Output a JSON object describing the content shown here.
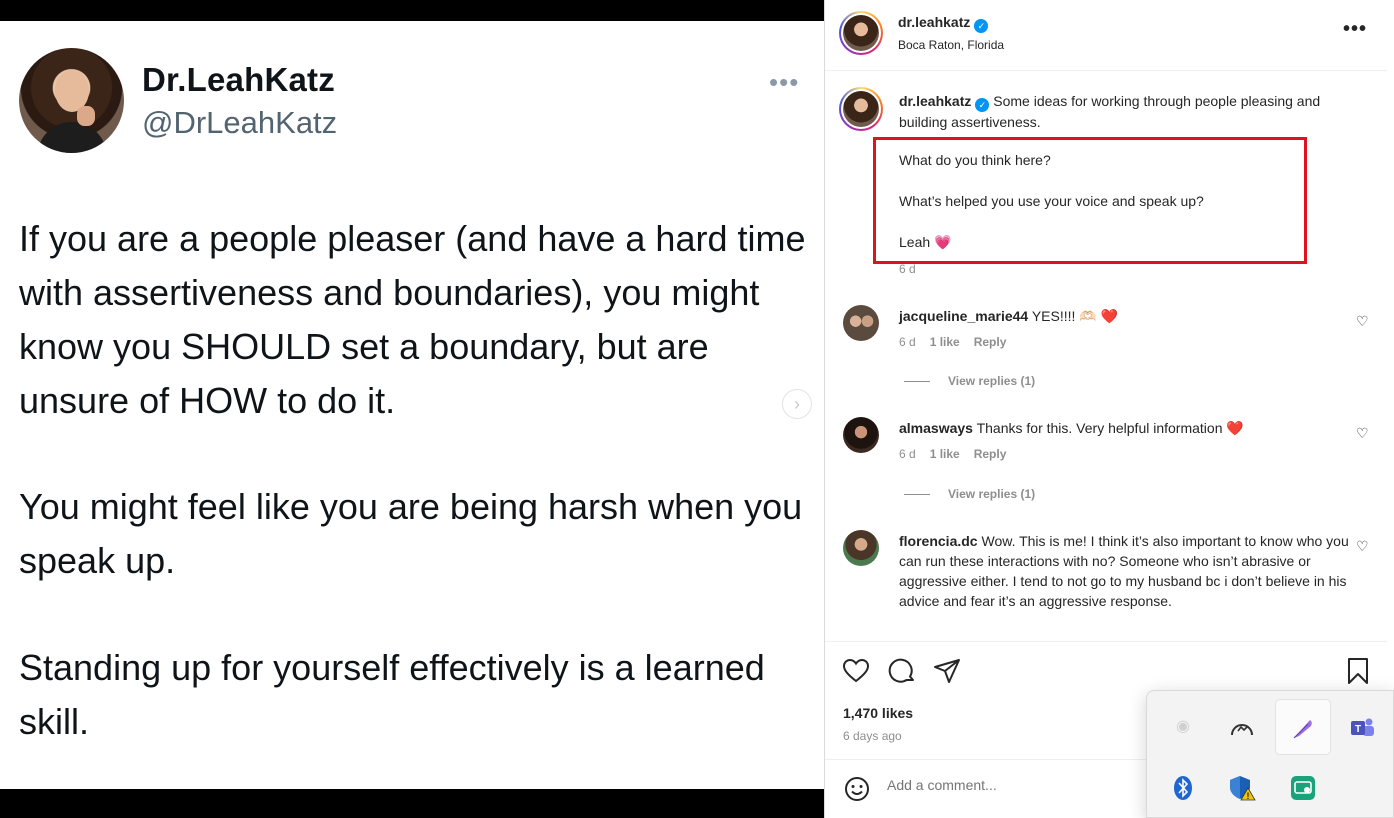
{
  "tweet": {
    "name": "Dr.LeahKatz",
    "handle": "@DrLeahKatz",
    "more": "•••",
    "paragraphs": [
      "If you are a people pleaser (and have a hard time with assertiveness and boundaries), you might know you SHOULD set a boundary, but are unsure of HOW to do it.",
      "You might feel like you are being harsh when you speak up.",
      "Standing up for yourself effectively is a learned skill."
    ],
    "next_icon": "chevron-right-icon"
  },
  "header": {
    "username": "dr.leahkatz",
    "location": "Boca Raton, Florida",
    "more": "•••"
  },
  "caption": {
    "username": "dr.leahkatz",
    "text": "Some ideas for working through people pleasing and building assertiveness.",
    "line1": "What do you think here?",
    "line2": "What’s helped you use your voice and speak up?",
    "line3": "Leah 💗",
    "time": "6 d"
  },
  "comments": [
    {
      "username": "jacqueline_marie44",
      "text": "YES!!!! 🫶🏻 ❤️",
      "time": "6 d",
      "likes": "1 like",
      "reply": "Reply",
      "view_replies": "View replies (1)"
    },
    {
      "username": "almasways",
      "text": "Thanks for this. Very helpful information ❤️",
      "time": "6 d",
      "likes": "1 like",
      "reply": "Reply",
      "view_replies": "View replies (1)"
    },
    {
      "username": "florencia.dc",
      "text": "Wow. This is me! I think it’s also important to know who you can run these interactions with no? Someone who isn’t abrasive or aggressive either. I tend to not go to my husband bc i don’t believe in his advice and fear it’s an aggressive response."
    }
  ],
  "footer": {
    "likes": "1,470 likes",
    "ago": "6 days ago",
    "comment_placeholder": "Add a comment..."
  },
  "colors": {
    "highlight": "#e0121c",
    "verified": "#0095f6"
  }
}
